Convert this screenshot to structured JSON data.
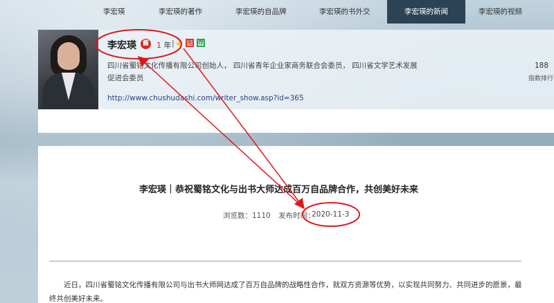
{
  "profile": {
    "name": "李宏瑛",
    "badge": "酱",
    "years_value": "1",
    "years_unit": "年",
    "separator": "|",
    "icon2_label": "图",
    "icon3_label": "荐",
    "bio": "四川省蜀铭文化传播有限公司创始人， 四川省青年企业家商务联合会委员， 四川省文学艺术发展促进会委员",
    "url": "http://www.chushudashi.com/writer_show.asp?id=365",
    "stat_value": "188",
    "stat_label": "指数排行"
  },
  "nav": {
    "items": [
      {
        "label": "李宏瑛"
      },
      {
        "label": "李宏瑛的著作"
      },
      {
        "label": "李宏瑛的自品牌"
      },
      {
        "label": "李宏瑛的书外交"
      },
      {
        "label": "李宏瑛的新闻"
      },
      {
        "label": "李宏瑛的视频"
      }
    ],
    "active_index": 4
  },
  "article": {
    "title": "李宏瑛｜恭祝蜀铭文化与出书大师达成百万自品牌合作，共创美好未来",
    "views_label": "浏览数：",
    "views_value": "1110",
    "published_label": "发布时间：",
    "published_value": "2020-11-3",
    "body": "近日，四川省蜀铭文化传播有限公司与出书大师网达成了百万自品牌的战略性合作，就双方资源等优势，以实现共同努力、共同进步的愿景，最终共创美好未来。"
  },
  "colors": {
    "annotation": "#e0161d",
    "nav_active_bg": "#2c4356",
    "link": "#2b3f86"
  }
}
